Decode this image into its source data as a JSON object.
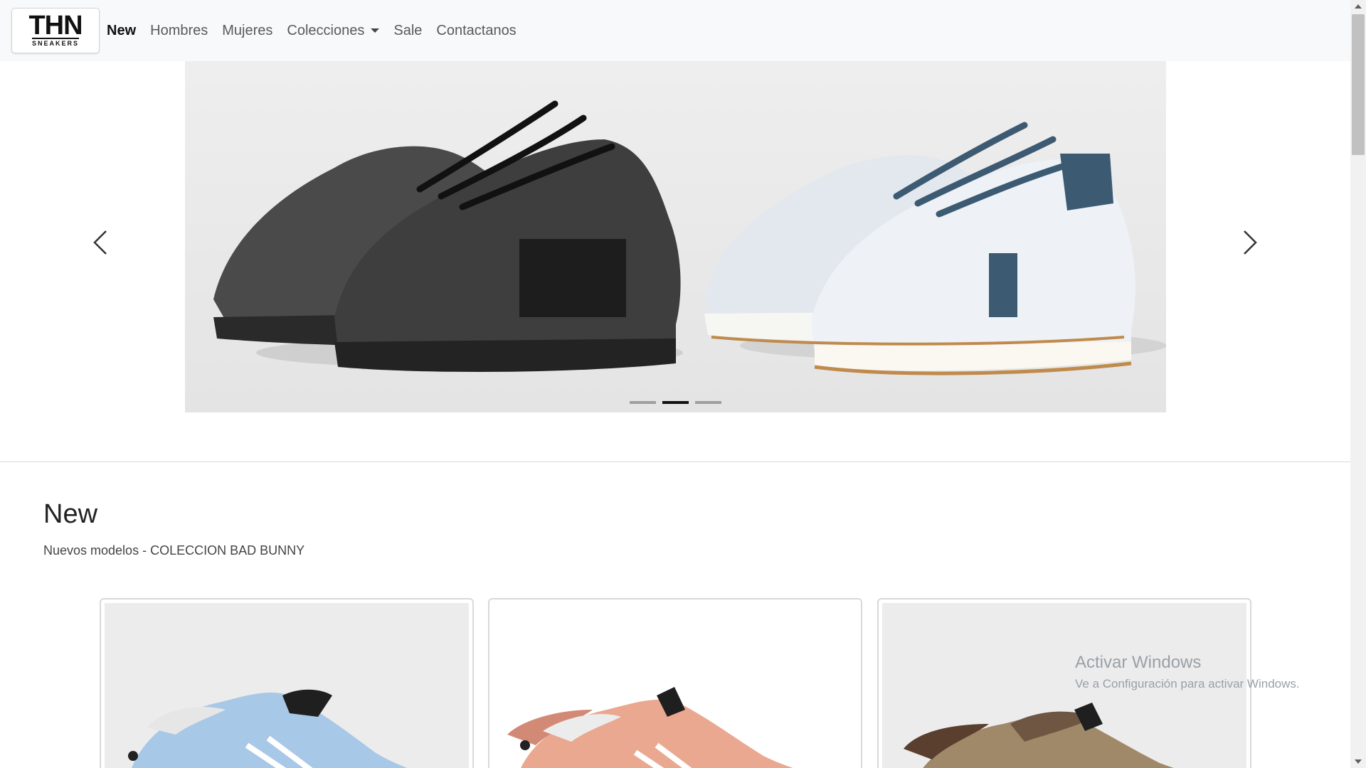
{
  "brand": {
    "main": "THN",
    "sub": "SNEAKERS"
  },
  "nav": {
    "items": [
      {
        "label": "New",
        "active": true
      },
      {
        "label": "Hombres"
      },
      {
        "label": "Mujeres"
      },
      {
        "label": "Colecciones",
        "dropdown": true
      },
      {
        "label": "Sale"
      },
      {
        "label": "Contactanos"
      }
    ]
  },
  "carousel": {
    "prev_icon": "chevron-left-icon",
    "next_icon": "chevron-right-icon",
    "slides_count": 3,
    "active_index": 1
  },
  "section": {
    "title": "New",
    "subtitle": "Nuevos modelos - COLECCION BAD BUNNY"
  },
  "windows_watermark": {
    "title": "Activar Windows",
    "subtitle": "Ve a Configuración para activar Windows."
  },
  "colors": {
    "navbar_bg": "#f8f9fa",
    "active_link": "#111111",
    "link": "#5a5a5a"
  }
}
